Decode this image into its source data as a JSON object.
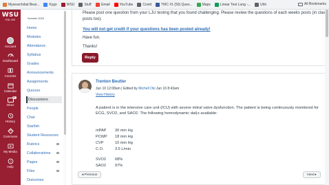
{
  "bookmarks": {
    "items": [
      {
        "label": "Mysearchdial Bear...",
        "color": "#e07b39"
      },
      {
        "label": "Kygo",
        "color": "#4285f4"
      },
      {
        "label": "WSU",
        "color": "#981e32"
      },
      {
        "label": "Stuff",
        "color": "#5f6368"
      },
      {
        "label": "Gmail",
        "color": "#ea4335"
      },
      {
        "label": "YouTube",
        "color": "#ff0000"
      },
      {
        "label": "Covid",
        "color": "#5f6368"
      },
      {
        "label": "TMC #1 (50) Ques...",
        "color": "#3b5998"
      },
      {
        "label": "Maps",
        "color": "#34a853"
      },
      {
        "label": "Linear Test Lung -...",
        "color": "#0f9d58"
      },
      {
        "label": "Uhh",
        "color": "#5f6368"
      }
    ],
    "all_label": "All Bookmarks"
  },
  "global_nav": {
    "logo_main": "WSU",
    "logo_sub": "ONLINE",
    "items": [
      {
        "label": "Account",
        "icon": "avatar-icon"
      },
      {
        "label": "Dashboard",
        "icon": "dashboard-icon"
      },
      {
        "label": "Courses",
        "icon": "courses-icon"
      },
      {
        "label": "Calendar",
        "icon": "calendar-icon"
      },
      {
        "label": "Inbox",
        "icon": "inbox-icon",
        "badge": "37"
      },
      {
        "label": "History",
        "icon": "history-icon"
      },
      {
        "label": "Commons",
        "icon": "commons-icon"
      },
      {
        "label": "My Media",
        "icon": "media-icon"
      },
      {
        "label": "Help",
        "icon": "help-icon"
      }
    ]
  },
  "course_nav": {
    "term": "Summer 2023",
    "items": [
      "Home",
      "Modules",
      "Attendance",
      "Syllabus",
      "Grades",
      "Announcements",
      "Assignments",
      "Quizzes",
      "Discussions",
      "People",
      "Chat",
      "Starfish",
      "Student Resources",
      "Rubrics",
      "Collaborations",
      "Pages",
      "Files",
      "Outcomes"
    ],
    "active": "Discussions"
  },
  "previous_post": {
    "line1": "Please post one question from your LJU testing that you found challenging. Please review the questions of each weeks posts (in class",
    "line2": "posts too).",
    "warning": "You will not get credit if your questions has been posted already!",
    "fun": "Have fun.",
    "thanks": "Thanks!",
    "reply_label": "Reply"
  },
  "post": {
    "author": "Trenton Beutler",
    "date": "Jun 10 12:08am",
    "edited_prefix": "| Edited by",
    "editor": "Michell Oki",
    "edited_date": "Jun 10 8:43am",
    "view_history": "View History",
    "paragraph_part1": "A patient is in the intensive care unit (ICU) with severe mitral valve dysfunction. The patient is being continuously monitored for ECG, SVO2, and SAO2.  The following hemodynamic dat",
    "paragraph_part2": "s available:",
    "values": [
      {
        "key": "mPAP",
        "value": "30 mm Hg"
      },
      {
        "key": "PCWP",
        "value": "18 mm Hg"
      },
      {
        "key": "CVP",
        "value": "10 mm Hg"
      },
      {
        "key": "C.O.",
        "value": "3.5 L/min"
      },
      {
        "key": "SVO2",
        "value": "68%"
      },
      {
        "key": "SAO2",
        "value": "97%"
      }
    ]
  },
  "pager": {
    "previous": "◂ Previous",
    "next": "Next ▸"
  }
}
